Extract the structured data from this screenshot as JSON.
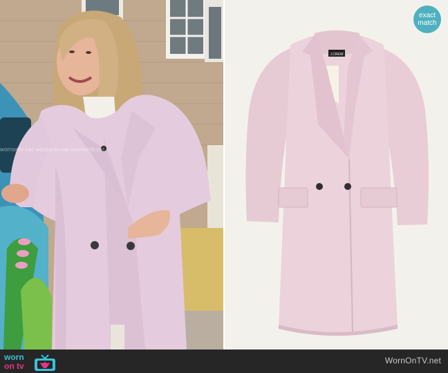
{
  "badge": {
    "line1": "exact",
    "line2": "match"
  },
  "logo": {
    "word_top": "worn",
    "word_bottom": "on tv"
  },
  "footer": {
    "site": "WornOnTV.net"
  },
  "watermark": "wornontv.net  wornontv.net  wornontv.net",
  "coat_label": "J.CREW",
  "colors": {
    "coat_pink": "#e9cfd9",
    "bar": "#262626",
    "badge": "#4fb0bf",
    "logo_cyan": "#36c3d8",
    "logo_pink": "#e2368a"
  },
  "icons": {
    "logo_tv": "tv-icon"
  }
}
